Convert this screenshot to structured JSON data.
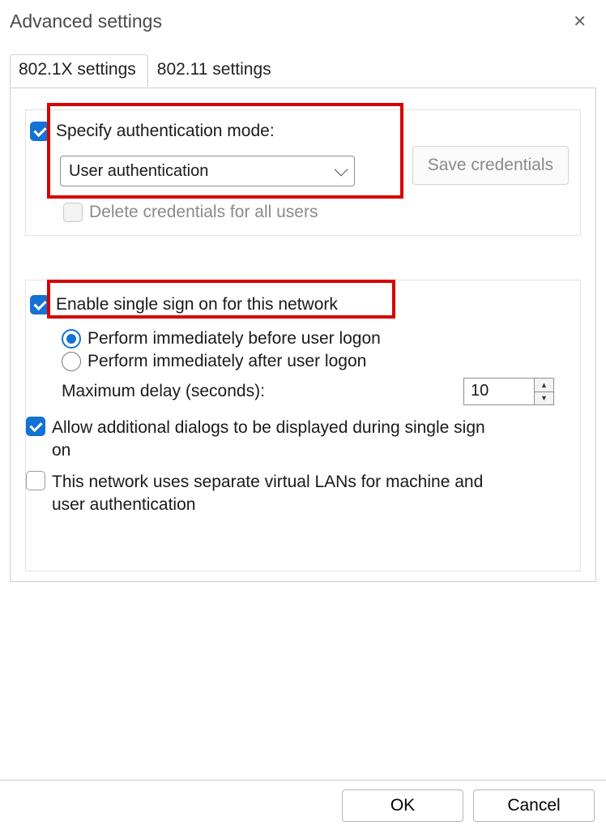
{
  "dialog": {
    "title": "Advanced settings"
  },
  "tabs": {
    "t1": "802.1X settings",
    "t2": "802.11 settings"
  },
  "auth": {
    "specify_label": "Specify authentication mode:",
    "dropdown_value": "User authentication",
    "save_btn": "Save credentials",
    "delete_label": "Delete credentials for all users"
  },
  "sso": {
    "enable_label": "Enable single sign on for this network",
    "radio_before": "Perform immediately before user logon",
    "radio_after": "Perform immediately after user logon",
    "max_delay_label": "Maximum delay (seconds):",
    "max_delay_value": "10",
    "allow_dialogs": "Allow additional dialogs to be displayed during single sign on",
    "separate_vlans": "This network uses separate virtual LANs for machine and user authentication"
  },
  "footer": {
    "ok": "OK",
    "cancel": "Cancel"
  }
}
